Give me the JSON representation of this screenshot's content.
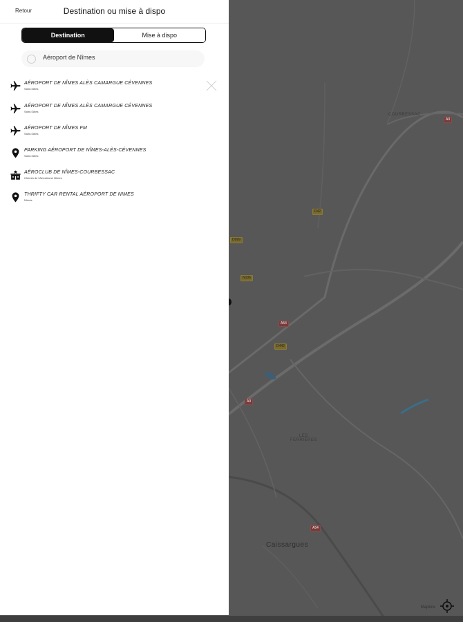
{
  "header": {
    "back_label": "Retour",
    "title": "Destination ou mise à dispo"
  },
  "tabs": [
    {
      "label": "Destination",
      "active": true
    },
    {
      "label": "Mise à dispo",
      "active": false
    }
  ],
  "search": {
    "value": "Aéroport de Nîmes",
    "placeholder": ""
  },
  "results": [
    {
      "icon": "plane-icon",
      "title": "AÉROPORT DE NÎMES ALÈS CAMARGUE CÉVENNES",
      "subtitle": "Saint-Gilles"
    },
    {
      "icon": "plane-icon",
      "title": "AÉROPORT DE NÎMES ALÈS CAMARGUE CÉVENNES",
      "subtitle": "Saint-Gilles"
    },
    {
      "icon": "plane-icon",
      "title": "AÉROPORT DE NÎMES FM",
      "subtitle": "Saint-Gilles"
    },
    {
      "icon": "map-pin-icon",
      "title": "PARKING AÉROPORT DE NÎMES-ALÈS-CÉVENNES",
      "subtitle": "Saint-Gilles"
    },
    {
      "icon": "club-building-icon",
      "title": "AÉROCLUB DE NÎMES-COURBESSAC",
      "subtitle": "Chemin de l'Aérodrome Nîmes"
    },
    {
      "icon": "map-pin-icon",
      "title": "THRIFTY CAR RENTAL AÉROPORT DE NIMES",
      "subtitle": "Nîmes"
    }
  ],
  "map": {
    "labels": [
      "COURBESSAC",
      "LES\nFERRIÈRES"
    ],
    "town": "Caissargues",
    "road_badges": [
      {
        "text": "D42",
        "color": "yellow"
      },
      {
        "text": "D999",
        "color": "yellow"
      },
      {
        "text": "N106",
        "color": "yellow"
      },
      {
        "text": "D442",
        "color": "yellow"
      },
      {
        "text": "A54",
        "color": "red"
      },
      {
        "text": "A9",
        "color": "red"
      },
      {
        "text": "A54",
        "color": "red"
      },
      {
        "text": "A9",
        "color": "red"
      }
    ],
    "attribution": "Mapbox"
  },
  "colors": {
    "panel_bg": "#ffffff",
    "map_bg": "#575757",
    "accent": "#111111"
  }
}
